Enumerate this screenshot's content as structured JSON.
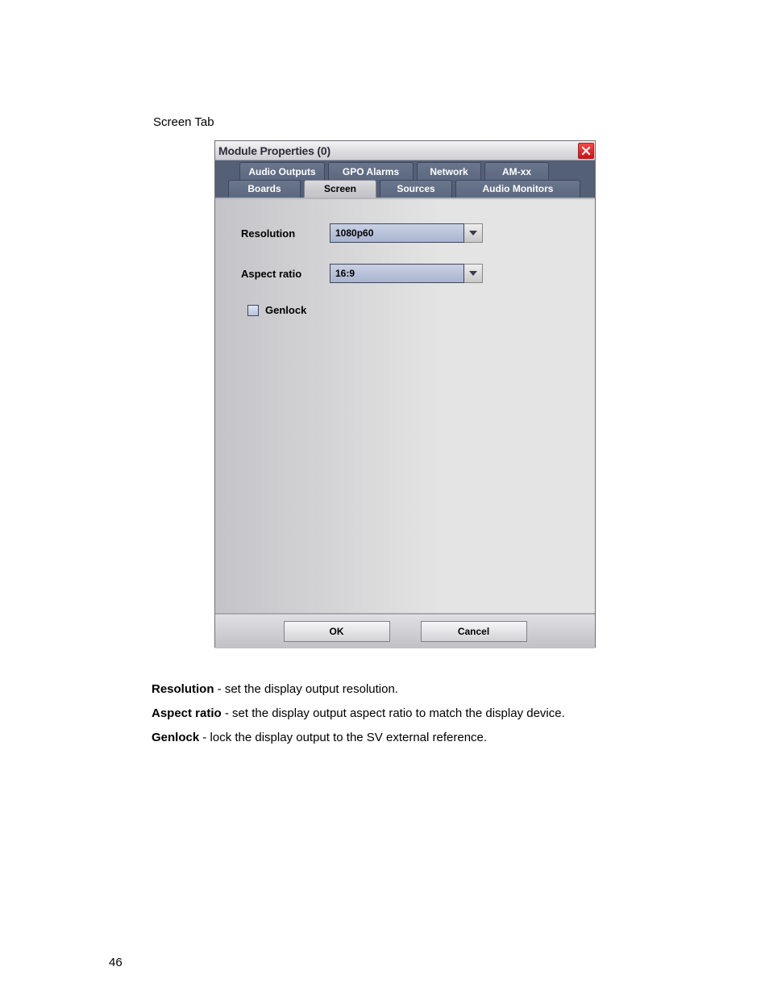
{
  "section_title": "Screen Tab",
  "dialog": {
    "title": "Module Properties (0)",
    "tabs_back": [
      "Audio Outputs",
      "GPO Alarms",
      "Network",
      "AM-xx"
    ],
    "tabs_front": [
      "Boards",
      "Screen",
      "Sources",
      "Audio Monitors"
    ],
    "active_tab": "Screen",
    "resolution": {
      "label": "Resolution",
      "value": "1080p60"
    },
    "aspect": {
      "label": "Aspect ratio",
      "value": "16:9"
    },
    "genlock": {
      "label": "Genlock",
      "checked": false
    },
    "ok": "OK",
    "cancel": "Cancel"
  },
  "descriptions": {
    "resolution": {
      "term": "Resolution",
      "text": " - set the display output resolution."
    },
    "aspect": {
      "term": "Aspect ratio",
      "text": " - set the display output aspect ratio to match the display device."
    },
    "genlock": {
      "term": "Genlock",
      "text": " - lock the display output to the SV external reference."
    }
  },
  "page_number": "46"
}
